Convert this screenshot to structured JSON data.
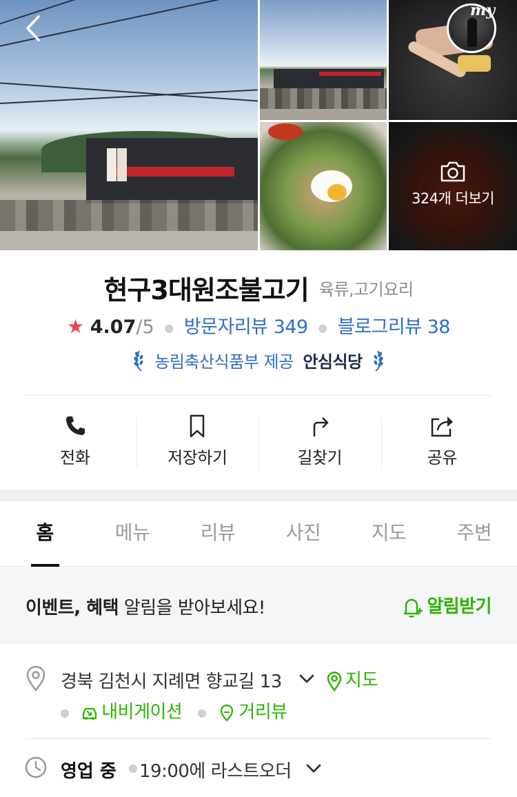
{
  "gallery": {
    "more_photos_label": "324개 더보기",
    "my_badge_label": "my"
  },
  "place": {
    "name": "현구3대원조불고기",
    "category": "육류,고기요리",
    "rating_star": "★",
    "rating": "4.07",
    "rating_max": "/5",
    "visitor_reviews": "방문자리뷰 349",
    "blog_reviews": "블로그리뷰 38",
    "cert_provider": "농림축산식품부 제공",
    "cert_name": "안심식당"
  },
  "actions": [
    {
      "label": "전화",
      "icon": "phone-icon"
    },
    {
      "label": "저장하기",
      "icon": "bookmark-icon"
    },
    {
      "label": "길찾기",
      "icon": "directions-icon"
    },
    {
      "label": "공유",
      "icon": "share-icon"
    }
  ],
  "tabs": [
    {
      "label": "홈",
      "active": true
    },
    {
      "label": "메뉴"
    },
    {
      "label": "리뷰"
    },
    {
      "label": "사진"
    },
    {
      "label": "지도"
    },
    {
      "label": "주변"
    }
  ],
  "banner": {
    "bold_part": "이벤트, 혜택",
    "rest": " 알림을 받아보세요!",
    "action": "알림받기"
  },
  "address": {
    "text": "경북 김천시 지례면 향교길 13",
    "map_link": "지도",
    "navigation_link": "내비게이션",
    "streetview_link": "거리뷰"
  },
  "hours": {
    "status": "영업 중",
    "detail": "19:00에 라스트오더"
  },
  "colors": {
    "accent_blue": "#2f6dc6",
    "accent_green": "#2db400",
    "star_red": "#f2434e"
  }
}
